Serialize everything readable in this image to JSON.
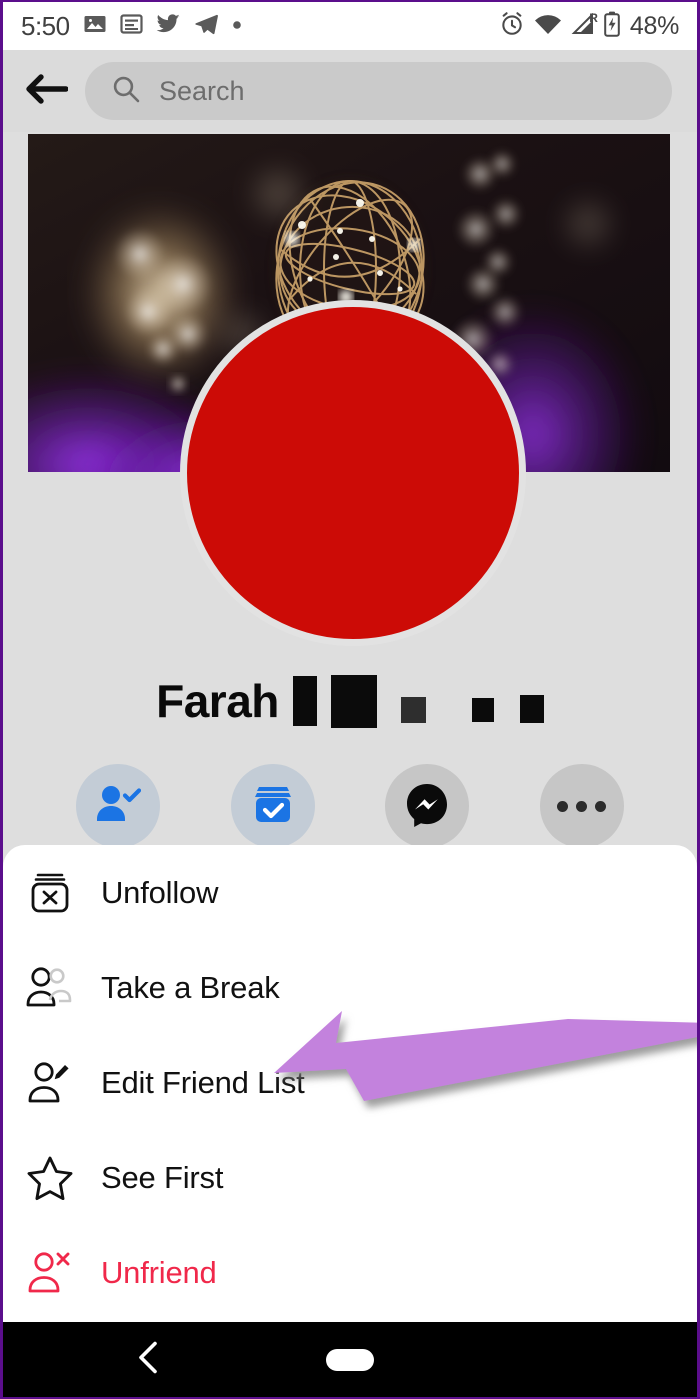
{
  "status_bar": {
    "time": "5:50",
    "battery_percent": "48%",
    "roaming_label": "R",
    "left_icons": [
      "photos-icon",
      "news-icon",
      "twitter-icon",
      "telegram-icon",
      "dot-icon"
    ],
    "right_icons": [
      "alarm-icon",
      "wifi-icon",
      "signal-icon",
      "battery-charging-icon"
    ]
  },
  "top_bar": {
    "back_icon": "back-arrow-icon",
    "search_placeholder": "Search",
    "search_icon": "search-icon"
  },
  "profile": {
    "name": "Farah",
    "name_redacted": true,
    "cover_photo_description": "bokeh fairy lights",
    "avatar_color": "#cc0b06",
    "avatar_redacted": true
  },
  "action_buttons": [
    {
      "name": "friends-button",
      "icon": "person-check-icon",
      "style": "blue"
    },
    {
      "name": "following-button",
      "icon": "following-box-check-icon",
      "style": "blue"
    },
    {
      "name": "message-button",
      "icon": "messenger-icon",
      "style": "gray"
    },
    {
      "name": "more-options-button",
      "icon": "more-dots-icon",
      "style": "gray"
    }
  ],
  "bottom_sheet": {
    "menu_items": [
      {
        "label": "Unfollow",
        "icon": "unfollow-box-x-icon",
        "danger": false
      },
      {
        "label": "Take a Break",
        "icon": "two-people-icon",
        "danger": false
      },
      {
        "label": "Edit Friend List",
        "icon": "person-pencil-icon",
        "danger": false
      },
      {
        "label": "See First",
        "icon": "star-outline-icon",
        "danger": false
      },
      {
        "label": "Unfriend",
        "icon": "person-x-icon",
        "danger": true
      }
    ]
  },
  "annotation": {
    "type": "arrow",
    "color": "#c382dd",
    "points_to": "Edit Friend List"
  },
  "nav_bar": {
    "back_icon": "nav-back-chevron-icon",
    "home_icon": "nav-home-pill-icon"
  },
  "colors": {
    "accent_blue": "#1b74e4",
    "danger_red": "#f0284a",
    "page_bg": "#dedede",
    "sheet_bg": "#ffffff",
    "annotation_purple": "#c382dd"
  }
}
